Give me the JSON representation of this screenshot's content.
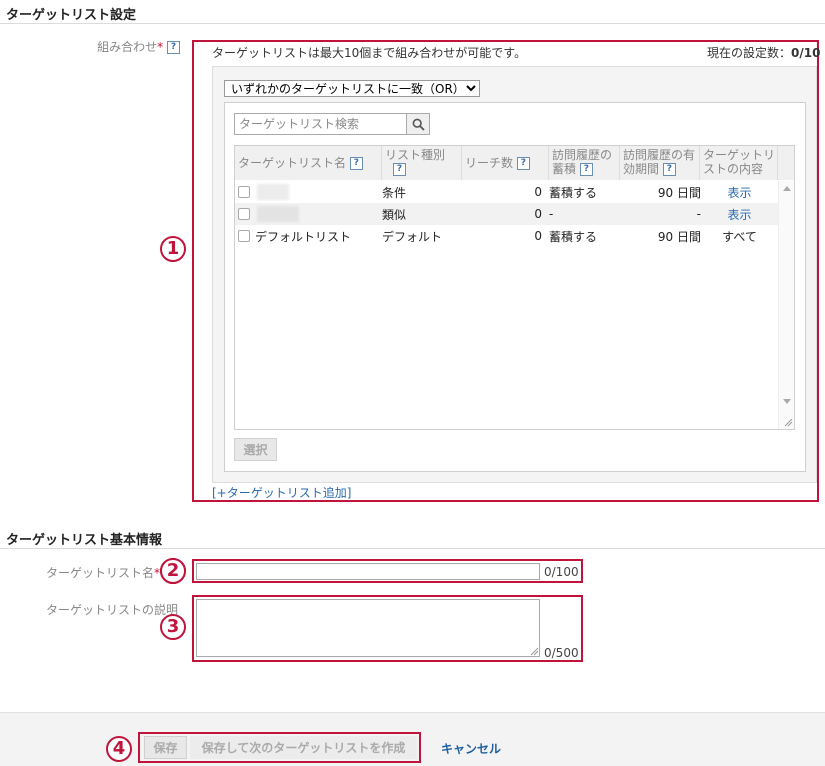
{
  "section1": {
    "title": "ターゲットリスト設定",
    "combine_label": "組み合わせ",
    "info_text": "ターゲットリストは最大10個まで組み合わせが可能です。",
    "current_label": "現在の設定数：",
    "current_value": "0/10",
    "match_select": "いずれかのターゲットリストに一致（OR）",
    "search_placeholder": "ターゲットリスト検索",
    "columns": [
      "ターゲットリスト名",
      "リスト種別",
      "リーチ数",
      "訪問履歴の蓄積",
      "訪問履歴の有効期間",
      "ターゲットリストの内容"
    ],
    "rows": [
      {
        "name": "",
        "type": "条件",
        "reach": "0",
        "accumulate": "蓄積する",
        "period": "90 日間",
        "content": "表示",
        "content_link": true
      },
      {
        "name": "",
        "type": "類似",
        "reach": "0",
        "accumulate": "-",
        "period": "-",
        "content": "表示",
        "content_link": true
      },
      {
        "name": "デフォルトリスト",
        "type": "デフォルト",
        "reach": "0",
        "accumulate": "蓄積する",
        "period": "90 日間",
        "content": "すべて",
        "content_link": false
      }
    ],
    "select_button": "選択",
    "add_link": "[+ターゲットリスト追加]"
  },
  "section2": {
    "title": "ターゲットリスト基本情報",
    "name_label": "ターゲットリスト名",
    "name_value": "",
    "name_counter": "0/100",
    "desc_label": "ターゲットリストの説明",
    "desc_value": "",
    "desc_counter": "0/500"
  },
  "footer": {
    "save_button": "保存",
    "save_next_button": "保存して次のターゲットリストを作成",
    "cancel_link": "キャンセル"
  },
  "callouts": [
    "1",
    "2",
    "3",
    "4"
  ],
  "icons": {
    "help": "question-icon",
    "search": "search-icon",
    "select_arrow": "caret-down-icon"
  },
  "colors": {
    "callout": "#c0143c",
    "link": "#2a6ab0",
    "required": "#c8102e"
  }
}
